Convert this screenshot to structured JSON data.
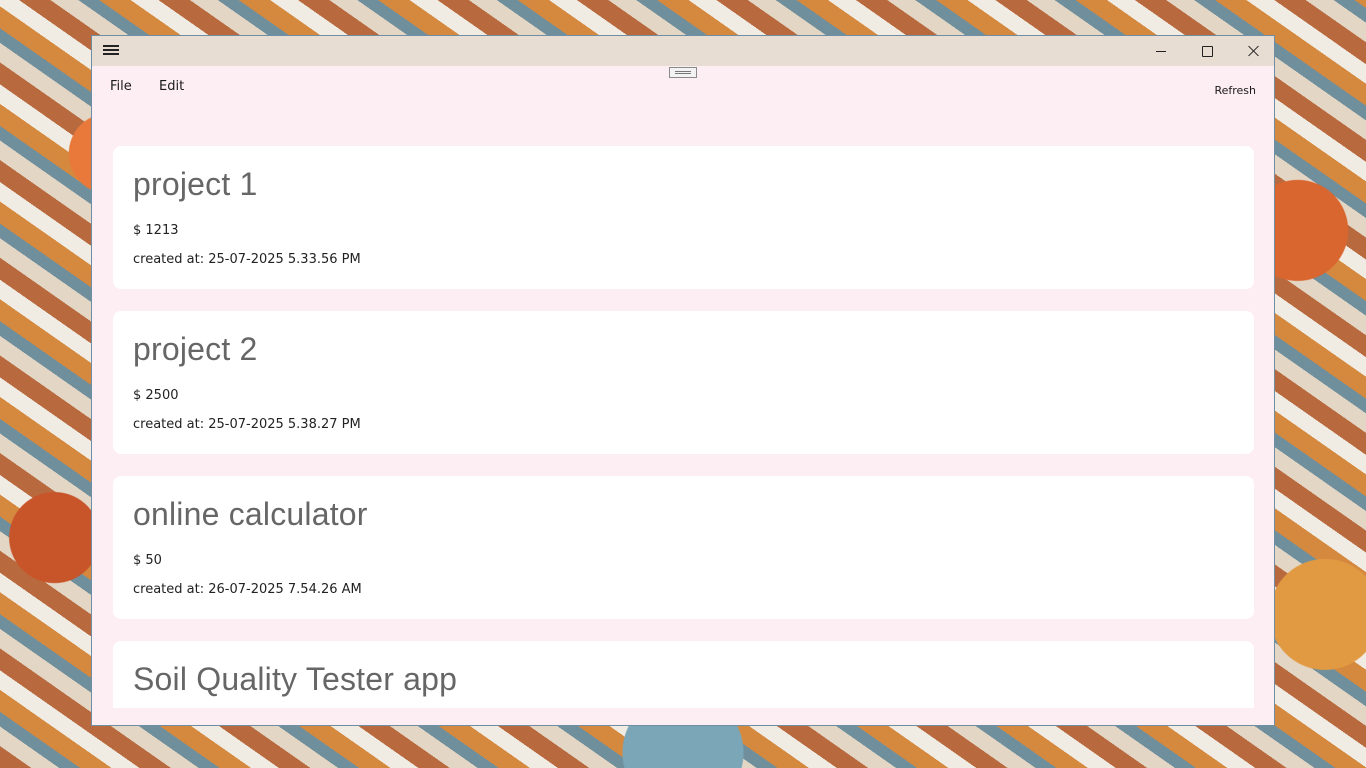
{
  "menu": {
    "file": "File",
    "edit": "Edit",
    "refresh": "Refresh"
  },
  "projects": [
    {
      "title": "project 1",
      "amount": "$ 1213",
      "created": "created at: 25-07-2025 5.33.56 PM"
    },
    {
      "title": "project 2",
      "amount": "$ 2500",
      "created": "created at: 25-07-2025 5.38.27 PM"
    },
    {
      "title": "online calculator",
      "amount": "$ 50",
      "created": "created at: 26-07-2025 7.54.26 AM"
    },
    {
      "title": "Soil Quality Tester app",
      "amount": "",
      "created": ""
    }
  ]
}
